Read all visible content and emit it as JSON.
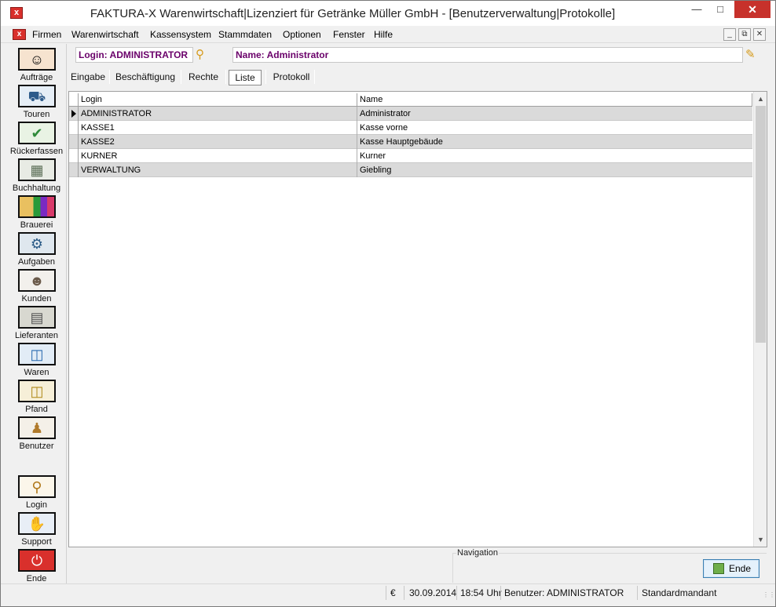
{
  "window": {
    "title": "FAKTURA-X Warenwirtschaft|Lizenziert für Getränke Müller GmbH - [Benutzerverwaltung|Protokolle]",
    "icon": "app-x-icon"
  },
  "menu": {
    "items": [
      "Firmen",
      "Warenwirtschaft",
      "Kassensystem",
      "Stammdaten",
      "Optionen",
      "Fenster",
      "Hilfe"
    ]
  },
  "sidebar": {
    "items": [
      {
        "label": "Aufträge",
        "icon": "headset-agent-icon"
      },
      {
        "label": "Touren",
        "icon": "truck-icon"
      },
      {
        "label": "Rückerfassen",
        "icon": "return-truck-icon"
      },
      {
        "label": "Buchhaltung",
        "icon": "money-icon"
      },
      {
        "label": "Brauerei",
        "icon": "brewery-icon"
      },
      {
        "label": "Aufgaben",
        "icon": "tasks-icon"
      },
      {
        "label": "Kunden",
        "icon": "customers-icon"
      },
      {
        "label": "Lieferanten",
        "icon": "suppliers-icon"
      },
      {
        "label": "Waren",
        "icon": "goods-icon"
      },
      {
        "label": "Pfand",
        "icon": "deposit-icon"
      },
      {
        "label": "Benutzer",
        "icon": "user-icon"
      },
      {
        "label": "Login",
        "icon": "key-icon"
      },
      {
        "label": "Support",
        "icon": "handshake-icon"
      },
      {
        "label": "Ende",
        "icon": "power-icon"
      }
    ]
  },
  "header": {
    "login": "Login: ADMINISTRATOR",
    "name": "Name: Administrator"
  },
  "tabs": [
    "Eingabe",
    "Beschäftigung",
    "Rechte",
    "Liste",
    "Protokoll"
  ],
  "active_tab": "Liste",
  "grid": {
    "columns": [
      "Login",
      "Name"
    ],
    "rows": [
      {
        "login": "ADMINISTRATOR",
        "name": "Administrator"
      },
      {
        "login": "KASSE1",
        "name": "Kasse vorne"
      },
      {
        "login": "KASSE2",
        "name": "Kasse Hauptgebäude"
      },
      {
        "login": "KURNER",
        "name": "Kurner"
      },
      {
        "login": "VERWALTUNG",
        "name": "Giebling"
      }
    ],
    "selected_row": 0
  },
  "navigation": {
    "label": "Navigation",
    "ende_button": "Ende"
  },
  "status": {
    "currency": "€",
    "date": "30.09.2014",
    "time": "18:54 Uhr",
    "user": "Benutzer: ADMINISTRATOR",
    "mandant": "Standardmandant"
  },
  "colors": {
    "title_close": "#c7312b",
    "header_text": "#6a006a",
    "row_alt": "#dadada",
    "ende_power": "#d9302c"
  }
}
